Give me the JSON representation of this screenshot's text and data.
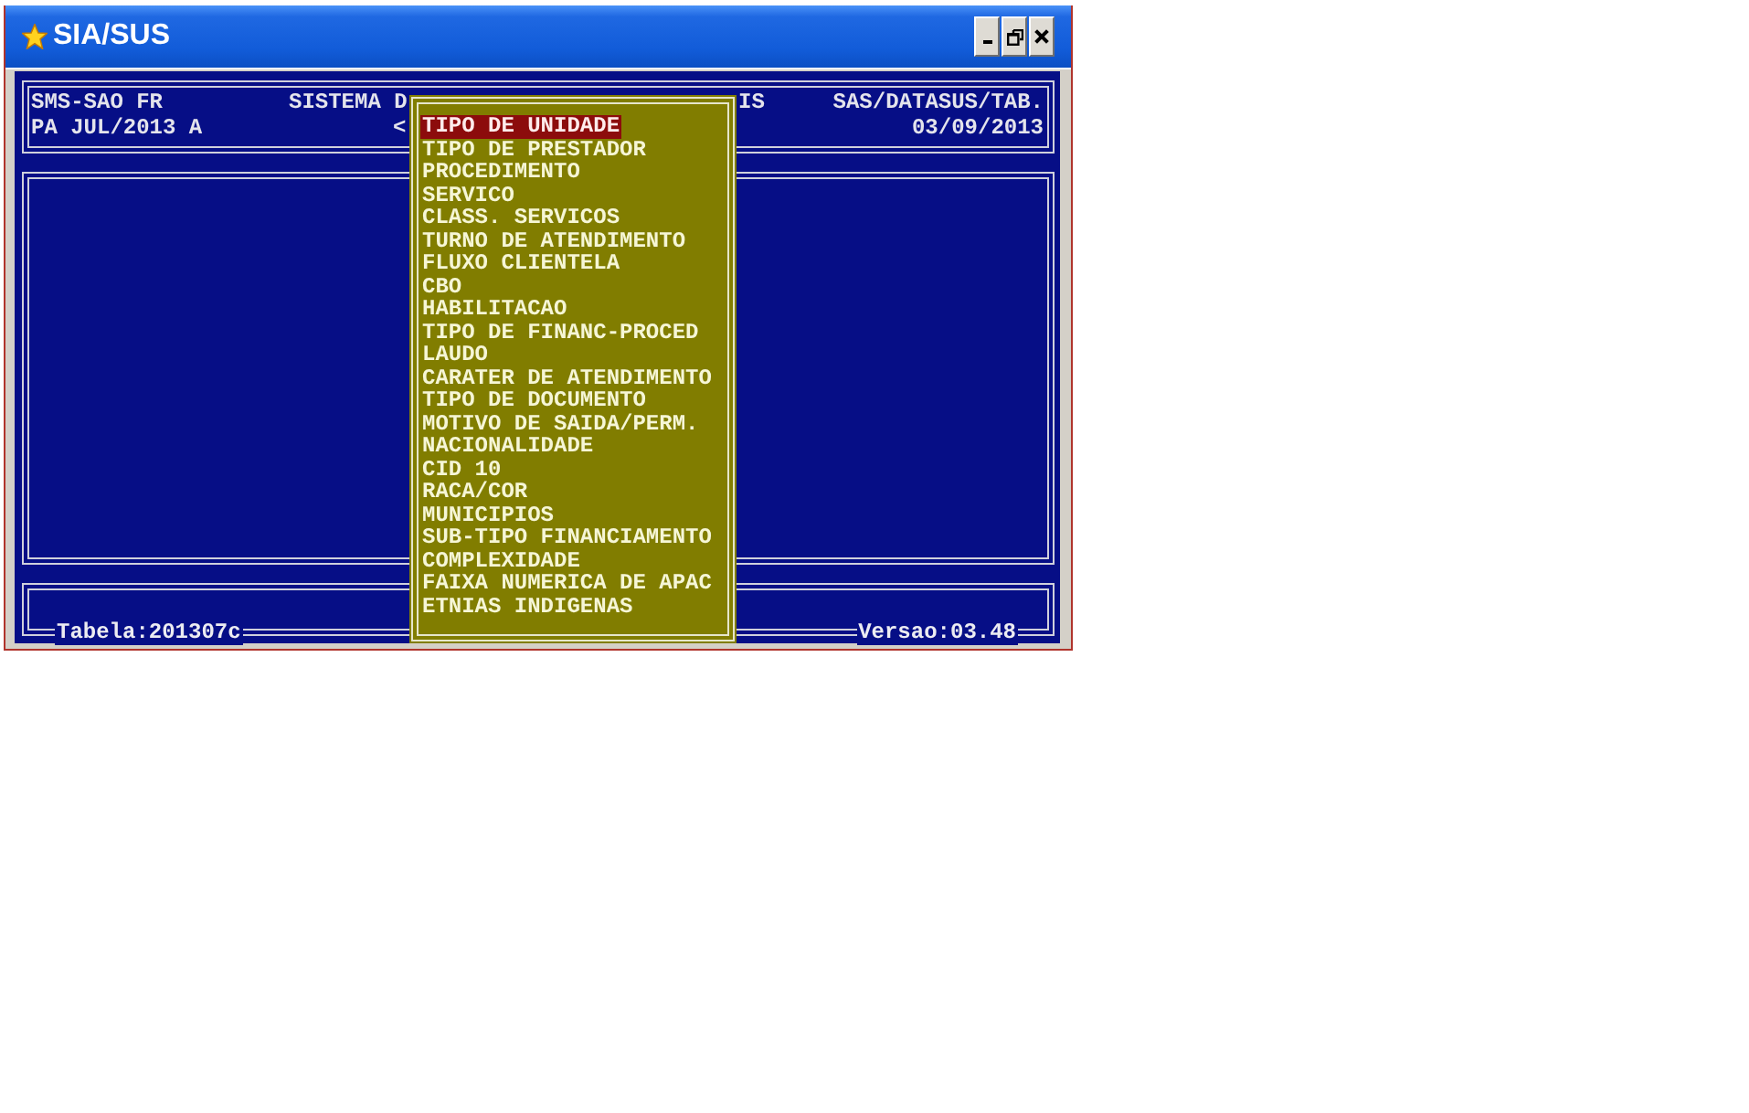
{
  "window": {
    "title": "SIA/SUS"
  },
  "header": {
    "line_1": {
      "left": "SMS-SAO FR",
      "center_left": "SISTEMA D",
      "center_right": "IS",
      "right": "SAS/DATASUS/TAB."
    },
    "line_2": {
      "left": "PA JUL/2013 A",
      "center_left": "<",
      "right": "03/09/2013"
    }
  },
  "menu": {
    "items": [
      {
        "label": "TIPO DE UNIDADE",
        "selected": true
      },
      {
        "label": "TIPO DE PRESTADOR",
        "selected": false
      },
      {
        "label": "PROCEDIMENTO",
        "selected": false
      },
      {
        "label": "SERVICO",
        "selected": false
      },
      {
        "label": "CLASS. SERVICOS",
        "selected": false
      },
      {
        "label": "TURNO DE ATENDIMENTO",
        "selected": false
      },
      {
        "label": "FLUXO CLIENTELA",
        "selected": false
      },
      {
        "label": "CBO",
        "selected": false
      },
      {
        "label": "HABILITACAO",
        "selected": false
      },
      {
        "label": "TIPO DE FINANC-PROCED",
        "selected": false
      },
      {
        "label": "LAUDO",
        "selected": false
      },
      {
        "label": "CARATER DE ATENDIMENTO",
        "selected": false
      },
      {
        "label": "TIPO DE DOCUMENTO",
        "selected": false
      },
      {
        "label": "MOTIVO DE SAIDA/PERM.",
        "selected": false
      },
      {
        "label": "NACIONALIDADE",
        "selected": false
      },
      {
        "label": "CID 10",
        "selected": false
      },
      {
        "label": "RACA/COR",
        "selected": false
      },
      {
        "label": "MUNICIPIOS",
        "selected": false
      },
      {
        "label": "SUB-TIPO FINANCIAMENTO",
        "selected": false
      },
      {
        "label": "COMPLEXIDADE",
        "selected": false
      },
      {
        "label": "FAIXA NUMERICA DE APAC",
        "selected": false
      },
      {
        "label": "ETNIAS INDIGENAS",
        "selected": false
      }
    ]
  },
  "footer": {
    "table": "Tabela:201307c",
    "version": "Versao:03.48"
  }
}
